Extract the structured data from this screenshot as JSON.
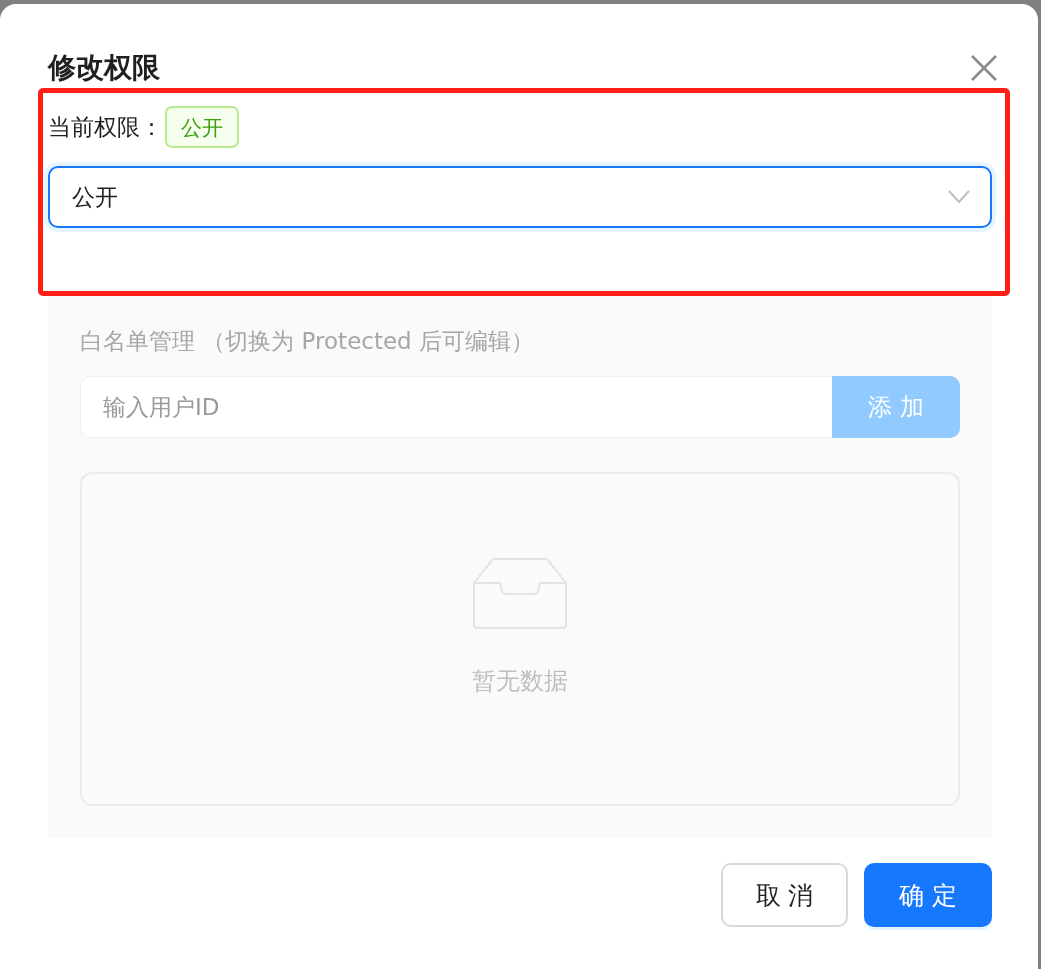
{
  "dialog": {
    "title": "修改权限"
  },
  "current_permission": {
    "label": "当前权限：",
    "tag": "公开"
  },
  "permission_select": {
    "value": "公开",
    "focused": true
  },
  "whitelist": {
    "disabled": true,
    "label": "白名单管理 （切换为 Protected 后可编辑）",
    "input": {
      "placeholder": "输入用户ID"
    },
    "add_button": "添 加",
    "empty_text": "暂无数据"
  },
  "footer": {
    "buttons": [
      {
        "label": "取 消",
        "kind": "default"
      },
      {
        "label": "确 定",
        "kind": "primary"
      }
    ]
  },
  "annotation": {
    "kind": "highlight-box"
  }
}
